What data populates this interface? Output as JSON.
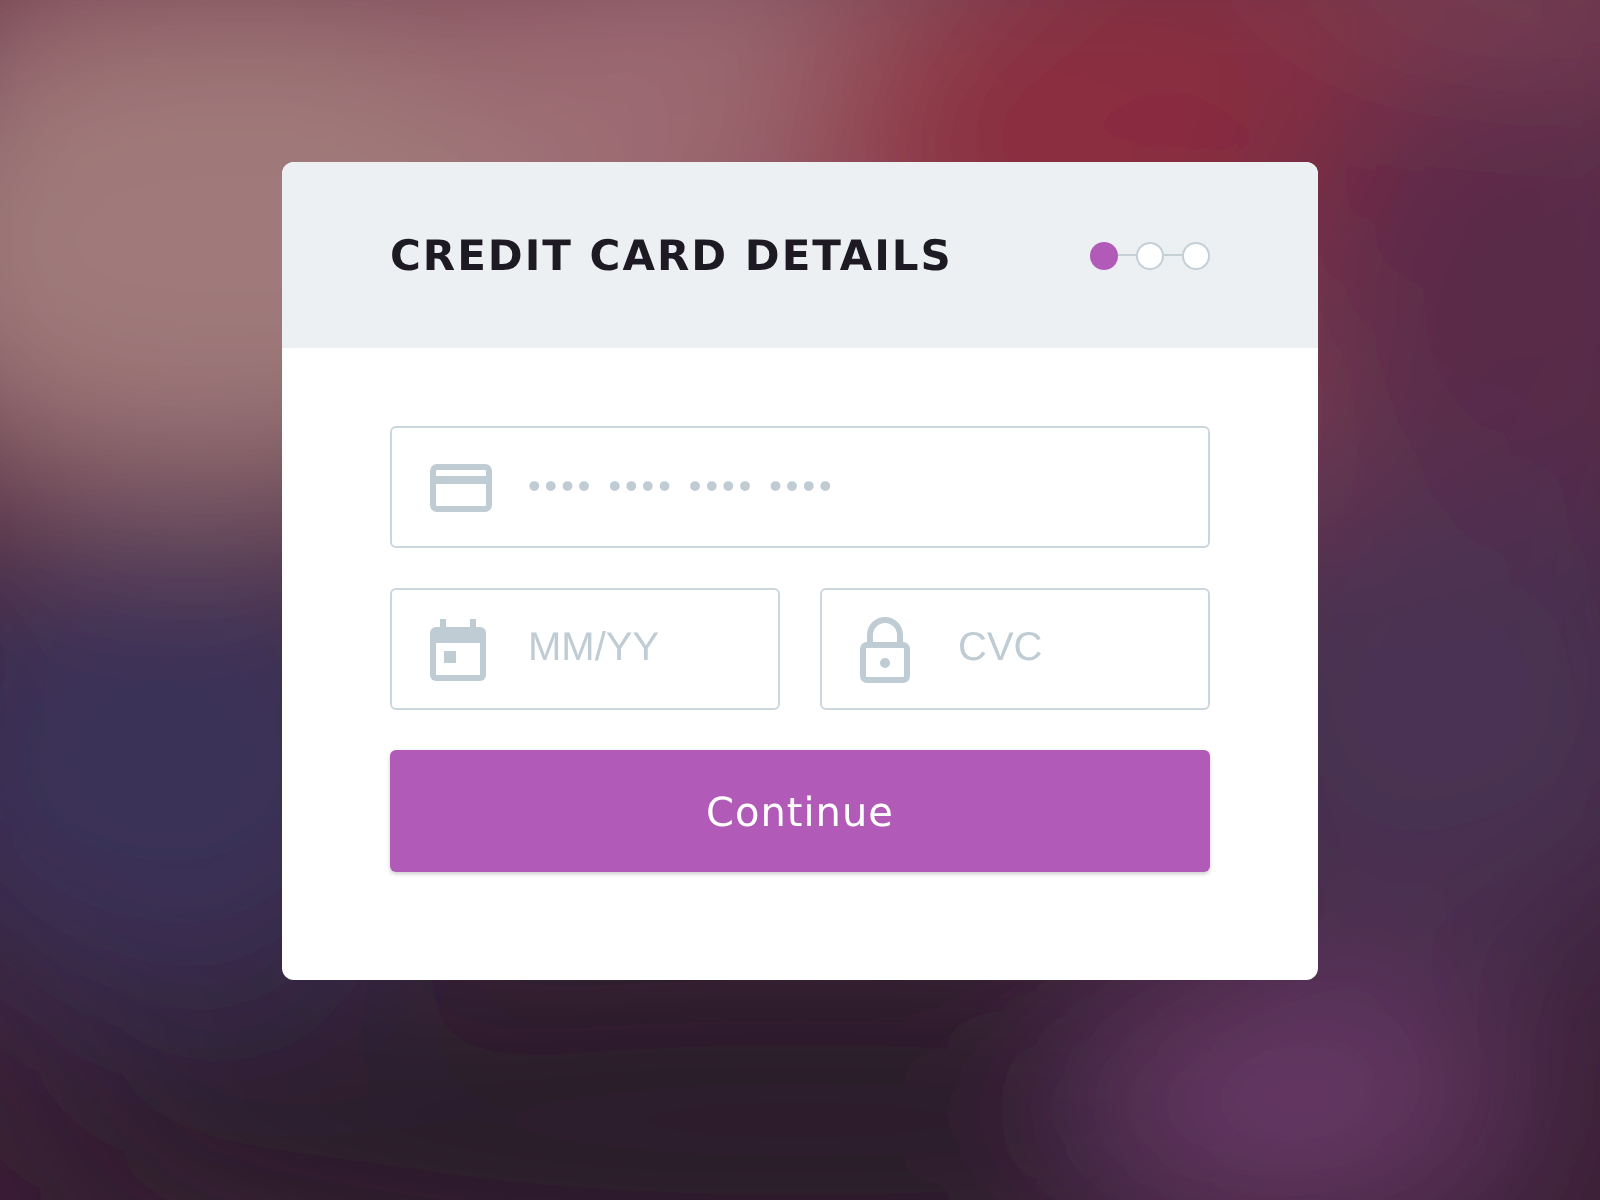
{
  "card": {
    "title": "CREDIT CARD DETAILS",
    "steps": [
      {
        "selected": true
      },
      {
        "selected": false
      },
      {
        "selected": false
      }
    ],
    "card_number": {
      "placeholder": "•••• •••• •••• ••••"
    },
    "expiry": {
      "placeholder": "MM/YY"
    },
    "cvc": {
      "placeholder": "CVC"
    },
    "button": "Continue"
  }
}
